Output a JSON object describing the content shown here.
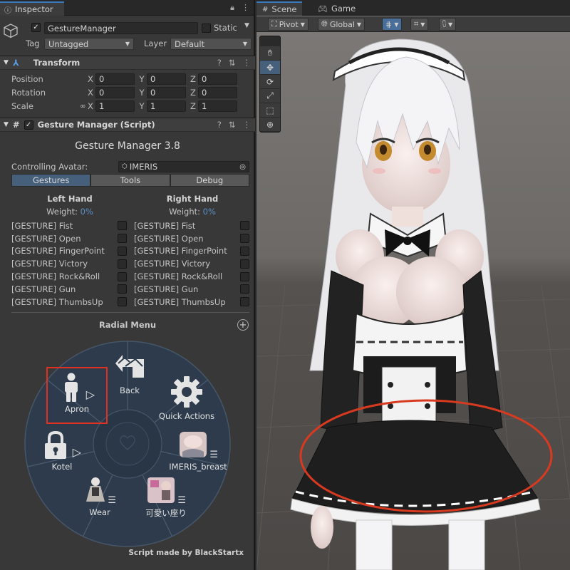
{
  "inspector": {
    "tab_label": "Inspector",
    "object_name": "GestureManager",
    "static_label": "Static",
    "tag_label": "Tag",
    "tag_value": "Untagged",
    "layer_label": "Layer",
    "layer_value": "Default"
  },
  "transform": {
    "title": "Transform",
    "rows": [
      {
        "label": "Position",
        "x": "0",
        "y": "0",
        "z": "0"
      },
      {
        "label": "Rotation",
        "x": "0",
        "y": "0",
        "z": "0"
      },
      {
        "label": "Scale",
        "x": "1",
        "y": "1",
        "z": "1"
      }
    ],
    "axis_x": "X",
    "axis_y": "Y",
    "axis_z": "Z"
  },
  "gesture_manager": {
    "component_title": "Gesture Manager (Script)",
    "title": "Gesture Manager 3.8",
    "controlling_label": "Controlling Avatar:",
    "avatar": "IMERIS",
    "tabs": [
      "Gestures",
      "Tools",
      "Debug"
    ],
    "left_hand": "Left Hand",
    "right_hand": "Right Hand",
    "weight_label": "Weight:",
    "weight_value": "0%",
    "gestures": [
      "[GESTURE] Fist",
      "[GESTURE] Open",
      "[GESTURE] FingerPoint",
      "[GESTURE] Victory",
      "[GESTURE] Rock&Roll",
      "[GESTURE] Gun",
      "[GESTURE] ThumbsUp"
    ],
    "radial_title": "Radial Menu",
    "credit": "Script made by BlackStartx"
  },
  "radial": {
    "items": [
      "Back",
      "Quick Actions",
      "IMERIS_breast",
      "可愛い座り",
      "Wear",
      "Kotel",
      "Apron"
    ],
    "highlight_color": "#e03020"
  },
  "scene": {
    "tab_scene": "Scene",
    "tab_game": "Game",
    "pivot": "Pivot",
    "global": "Global",
    "annotation_color": "#d83a20"
  }
}
